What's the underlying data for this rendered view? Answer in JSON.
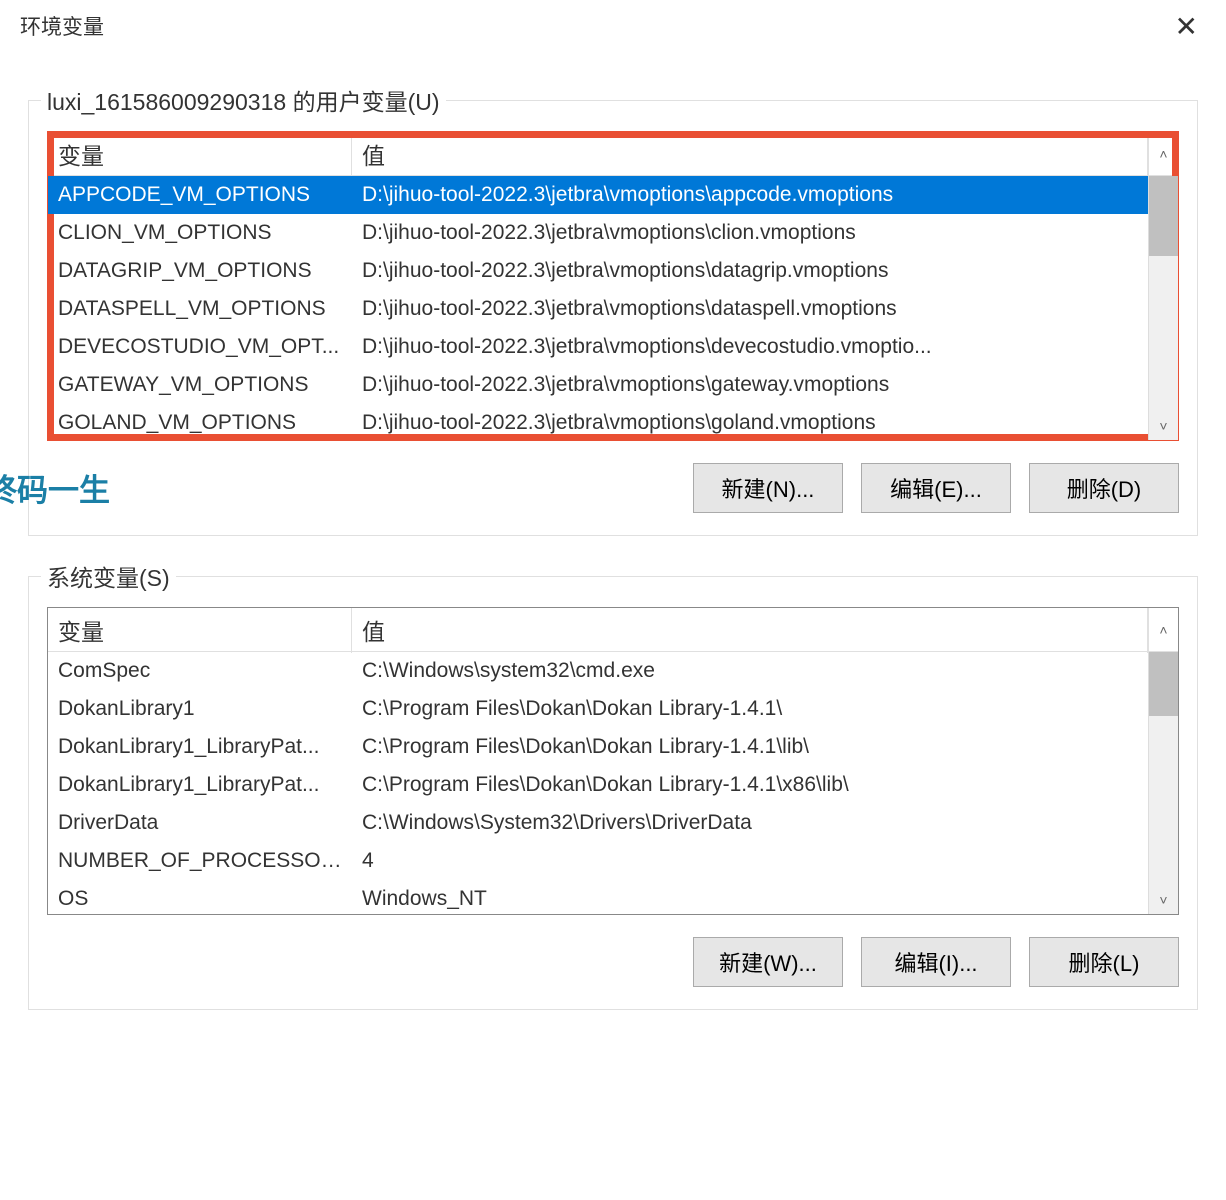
{
  "dialog": {
    "title": "环境变量",
    "close_icon": "✕"
  },
  "user_vars": {
    "legend": "luxi_161586009290318 的用户变量(U)",
    "headers": {
      "variable": "变量",
      "value": "值"
    },
    "rows": [
      {
        "var": "APPCODE_VM_OPTIONS",
        "val": "D:\\jihuo-tool-2022.3\\jetbra\\vmoptions\\appcode.vmoptions",
        "selected": true
      },
      {
        "var": "CLION_VM_OPTIONS",
        "val": "D:\\jihuo-tool-2022.3\\jetbra\\vmoptions\\clion.vmoptions"
      },
      {
        "var": "DATAGRIP_VM_OPTIONS",
        "val": "D:\\jihuo-tool-2022.3\\jetbra\\vmoptions\\datagrip.vmoptions"
      },
      {
        "var": "DATASPELL_VM_OPTIONS",
        "val": "D:\\jihuo-tool-2022.3\\jetbra\\vmoptions\\dataspell.vmoptions"
      },
      {
        "var": "DEVECOSTUDIO_VM_OPT...",
        "val": "D:\\jihuo-tool-2022.3\\jetbra\\vmoptions\\devecostudio.vmoptio..."
      },
      {
        "var": "GATEWAY_VM_OPTIONS",
        "val": "D:\\jihuo-tool-2022.3\\jetbra\\vmoptions\\gateway.vmoptions"
      },
      {
        "var": "GOLAND_VM_OPTIONS",
        "val": "D:\\jihuo-tool-2022.3\\jetbra\\vmoptions\\goland.vmoptions"
      }
    ],
    "buttons": {
      "new": "新建(N)...",
      "edit": "编辑(E)...",
      "delete": "删除(D)"
    }
  },
  "system_vars": {
    "legend": "系统变量(S)",
    "headers": {
      "variable": "变量",
      "value": "值"
    },
    "rows": [
      {
        "var": "ComSpec",
        "val": "C:\\Windows\\system32\\cmd.exe"
      },
      {
        "var": "DokanLibrary1",
        "val": "C:\\Program Files\\Dokan\\Dokan Library-1.4.1\\"
      },
      {
        "var": "DokanLibrary1_LibraryPat...",
        "val": "C:\\Program Files\\Dokan\\Dokan Library-1.4.1\\lib\\"
      },
      {
        "var": "DokanLibrary1_LibraryPat...",
        "val": "C:\\Program Files\\Dokan\\Dokan Library-1.4.1\\x86\\lib\\"
      },
      {
        "var": "DriverData",
        "val": "C:\\Windows\\System32\\Drivers\\DriverData"
      },
      {
        "var": "NUMBER_OF_PROCESSORS",
        "val": "4"
      },
      {
        "var": "OS",
        "val": "Windows_NT"
      }
    ],
    "buttons": {
      "new": "新建(W)...",
      "edit": "编辑(I)...",
      "delete": "删除(L)"
    }
  },
  "watermark": "公众号：终码一生",
  "icons": {
    "up": "˄",
    "down": "˅"
  }
}
